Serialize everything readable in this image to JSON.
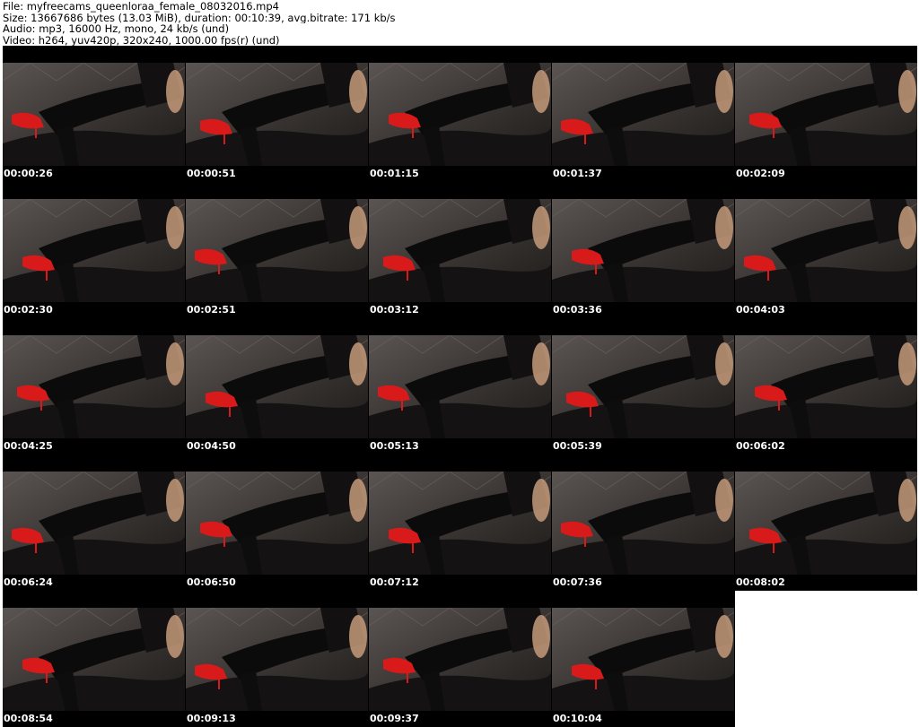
{
  "header": {
    "file_line": "File: myfreecams_queenloraa_female_08032016.mp4",
    "size_line": "Size: 13667686 bytes (13.03 MiB), duration: 00:10:39, avg.bitrate: 171 kb/s",
    "audio_line": "Audio: mp3, 16000 Hz, mono, 24 kb/s (und)",
    "video_line": "Video: h264, yuv420p, 320x240, 1000.00 fps(r) (und)"
  },
  "thumbnails": [
    {
      "timestamp": "00:00:26"
    },
    {
      "timestamp": "00:00:51"
    },
    {
      "timestamp": "00:01:15"
    },
    {
      "timestamp": "00:01:37"
    },
    {
      "timestamp": "00:02:09"
    },
    {
      "timestamp": "00:02:30"
    },
    {
      "timestamp": "00:02:51"
    },
    {
      "timestamp": "00:03:12"
    },
    {
      "timestamp": "00:03:36"
    },
    {
      "timestamp": "00:04:03"
    },
    {
      "timestamp": "00:04:25"
    },
    {
      "timestamp": "00:04:50"
    },
    {
      "timestamp": "00:05:13"
    },
    {
      "timestamp": "00:05:39"
    },
    {
      "timestamp": "00:06:02"
    },
    {
      "timestamp": "00:06:24"
    },
    {
      "timestamp": "00:06:50"
    },
    {
      "timestamp": "00:07:12"
    },
    {
      "timestamp": "00:07:36"
    },
    {
      "timestamp": "00:08:02"
    },
    {
      "timestamp": "00:08:54"
    },
    {
      "timestamp": "00:09:13"
    },
    {
      "timestamp": "00:09:37"
    },
    {
      "timestamp": "00:10:04"
    }
  ],
  "colors": {
    "sheet_background": "#000000",
    "timestamp_text": "#ffffff",
    "header_text": "#000000",
    "shoe_red": "#d81a1a"
  }
}
